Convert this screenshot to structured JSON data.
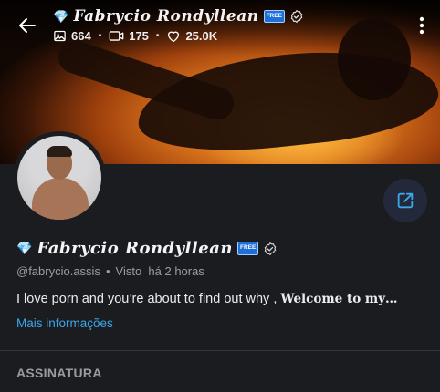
{
  "profile": {
    "display_name": "Fabrycio Rondyllean",
    "diamond_emoji": "💎",
    "free_badge": "FREE",
    "handle": "@fabrycio.assis",
    "last_seen": "Visto  há 2 horas",
    "bio_plain": "I love porn and you’re about to find out why ,",
    "bio_bold": "Welcome to my…",
    "more_info": "Mais informações"
  },
  "stats": {
    "photos": "664",
    "videos": "175",
    "likes": "25.0K"
  },
  "sections": {
    "subscription": "ASSINATURA"
  },
  "icons": {
    "back": "arrow-left-icon",
    "photos": "image-icon",
    "videos": "video-icon",
    "likes": "heart-icon",
    "verified": "verified-check-icon",
    "menu": "more-vertical-icon",
    "share": "share-icon"
  },
  "colors": {
    "background": "#1b1c20",
    "link": "#3aa7e8",
    "share_button": "#23283a",
    "free_badge": "#1e6fd9"
  }
}
